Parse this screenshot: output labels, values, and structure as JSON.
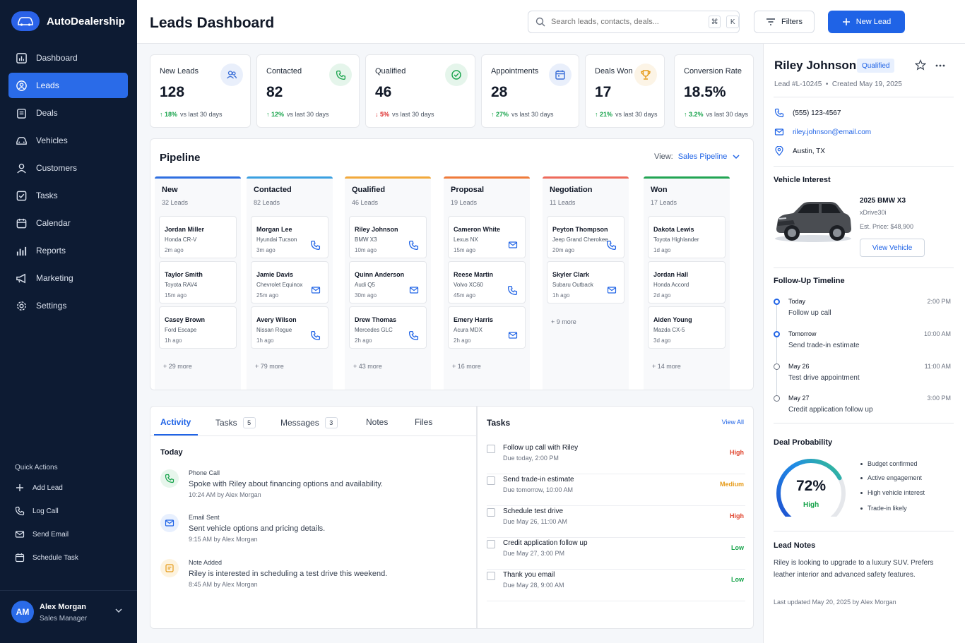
{
  "app": {
    "name": "AutoDealership"
  },
  "sidebar": {
    "items": [
      {
        "label": "Dashboard",
        "icon": "dashboard-icon"
      },
      {
        "label": "Leads",
        "icon": "leads-icon",
        "active": true
      },
      {
        "label": "Deals",
        "icon": "deals-icon"
      },
      {
        "label": "Vehicles",
        "icon": "car-icon"
      },
      {
        "label": "Customers",
        "icon": "user-icon"
      },
      {
        "label": "Tasks",
        "icon": "checkbox-icon"
      },
      {
        "label": "Calendar",
        "icon": "calendar-icon"
      },
      {
        "label": "Reports",
        "icon": "bar-chart-icon"
      },
      {
        "label": "Marketing",
        "icon": "megaphone-icon"
      },
      {
        "label": "Settings",
        "icon": "gear-icon"
      }
    ],
    "quick_actions_title": "Quick Actions",
    "quick_actions": [
      {
        "label": "Add Lead",
        "icon": "plus-icon"
      },
      {
        "label": "Log Call",
        "icon": "phone-icon"
      },
      {
        "label": "Send Email",
        "icon": "mail-icon"
      },
      {
        "label": "Schedule Task",
        "icon": "calendar-icon"
      }
    ],
    "user": {
      "initials": "AM",
      "name": "Alex Morgan",
      "role": "Sales Manager"
    }
  },
  "header": {
    "title": "Leads Dashboard",
    "search_placeholder": "Search leads, contacts, deals...",
    "kbd1": "⌘",
    "kbd2": "K",
    "filters_label": "Filters",
    "new_lead_label": "New Lead"
  },
  "stats": [
    {
      "label": "New Leads",
      "value": "128",
      "change": "18%",
      "direction": "up",
      "suffix": "vs last 30 days",
      "icon": "users-icon",
      "color": "#3b6fd8"
    },
    {
      "label": "Contacted",
      "value": "82",
      "change": "12%",
      "direction": "up",
      "suffix": "vs last 30 days",
      "icon": "phone-icon",
      "color": "#16a34a"
    },
    {
      "label": "Qualified",
      "value": "46",
      "change": "5%",
      "direction": "down",
      "suffix": "vs last 30 days",
      "icon": "check-circle-icon",
      "color": "#16a34a"
    },
    {
      "label": "Appointments",
      "value": "28",
      "change": "27%",
      "direction": "up",
      "suffix": "vs last 30 days",
      "icon": "calendar-icon",
      "color": "#3b6fd8"
    },
    {
      "label": "Deals Won",
      "value": "17",
      "change": "21%",
      "direction": "up",
      "suffix": "vs last 30 days",
      "icon": "trophy-icon",
      "color": "#e69b1a"
    },
    {
      "label": "Conversion Rate",
      "value": "18.5%",
      "change": "3.2%",
      "direction": "up",
      "suffix": "vs last 30 days",
      "icon": "none",
      "color": "#16a34a"
    }
  ],
  "pipeline": {
    "title": "Pipeline",
    "view_label": "View:",
    "view_value": "Sales Pipeline",
    "columns": [
      {
        "name": "New",
        "count": "32 Leads",
        "color": "#2f6fe0",
        "more": "+ 29 more",
        "cards": [
          {
            "name": "Jordan Miller",
            "car": "Honda CR-V",
            "time": "2m ago",
            "icon": ""
          },
          {
            "name": "Taylor Smith",
            "car": "Toyota RAV4",
            "time": "15m ago",
            "icon": ""
          },
          {
            "name": "Casey Brown",
            "car": "Ford Escape",
            "time": "1h ago",
            "icon": ""
          }
        ]
      },
      {
        "name": "Contacted",
        "count": "82 Leads",
        "color": "#3aa0e0",
        "more": "+ 79 more",
        "cards": [
          {
            "name": "Morgan Lee",
            "car": "Hyundai Tucson",
            "time": "3m ago",
            "icon": "phone"
          },
          {
            "name": "Jamie Davis",
            "car": "Chevrolet Equinox",
            "time": "25m ago",
            "icon": "mail"
          },
          {
            "name": "Avery Wilson",
            "car": "Nissan Rogue",
            "time": "1h ago",
            "icon": "phone"
          }
        ]
      },
      {
        "name": "Qualified",
        "count": "46 Leads",
        "color": "#f2a93b",
        "more": "+ 43 more",
        "cards": [
          {
            "name": "Riley Johnson",
            "car": "BMW X3",
            "time": "10m ago",
            "icon": "phone"
          },
          {
            "name": "Quinn Anderson",
            "car": "Audi Q5",
            "time": "30m ago",
            "icon": "mail"
          },
          {
            "name": "Drew Thomas",
            "car": "Mercedes GLC",
            "time": "2h ago",
            "icon": "phone"
          }
        ]
      },
      {
        "name": "Proposal",
        "count": "19 Leads",
        "color": "#ef7b3a",
        "more": "+ 16 more",
        "cards": [
          {
            "name": "Cameron White",
            "car": "Lexus NX",
            "time": "15m ago",
            "icon": "mail"
          },
          {
            "name": "Reese Martin",
            "car": "Volvo XC60",
            "time": "45m ago",
            "icon": "phone"
          },
          {
            "name": "Emery Harris",
            "car": "Acura MDX",
            "time": "2h ago",
            "icon": "mail"
          }
        ]
      },
      {
        "name": "Negotiation",
        "count": "11 Leads",
        "color": "#ee6a5b",
        "more": "+ 9 more",
        "cards": [
          {
            "name": "Peyton Thompson",
            "car": "Jeep Grand Cherokee",
            "time": "20m ago",
            "icon": "phone"
          },
          {
            "name": "Skyler Clark",
            "car": "Subaru Outback",
            "time": "1h ago",
            "icon": "mail"
          }
        ]
      },
      {
        "name": "Won",
        "count": "17 Leads",
        "color": "#22a553",
        "more": "+ 14 more",
        "cards": [
          {
            "name": "Dakota Lewis",
            "car": "Toyota Highlander",
            "time": "1d ago",
            "icon": ""
          },
          {
            "name": "Jordan Hall",
            "car": "Honda Accord",
            "time": "2d ago",
            "icon": ""
          },
          {
            "name": "Aiden Young",
            "car": "Mazda CX-5",
            "time": "3d ago",
            "icon": ""
          }
        ]
      }
    ]
  },
  "activity": {
    "tabs": [
      {
        "label": "Activity"
      },
      {
        "label": "Tasks",
        "badge": "5"
      },
      {
        "label": "Messages",
        "badge": "3"
      },
      {
        "label": "Notes"
      },
      {
        "label": "Files"
      }
    ],
    "today_label": "Today",
    "items": [
      {
        "type": "Phone Call",
        "desc": "Spoke with Riley about financing options and availability.",
        "time": "10:24 AM",
        "by": "by Alex Morgan",
        "icon": "phone-icon"
      },
      {
        "type": "Email Sent",
        "desc": "Sent vehicle options and pricing details.",
        "time": "9:15 AM",
        "by": "by Alex Morgan",
        "icon": "mail-icon"
      },
      {
        "type": "Note Added",
        "desc": "Riley is interested in scheduling a test drive this weekend.",
        "time": "8:45 AM",
        "by": "by Alex Morgan",
        "icon": "note-icon"
      }
    ]
  },
  "tasks": {
    "title": "Tasks",
    "view_all": "View All",
    "items": [
      {
        "title": "Follow up call with Riley",
        "due": "Due today, 2:00 PM",
        "priority": "High",
        "color": "#e0452f"
      },
      {
        "title": "Send trade-in estimate",
        "due": "Due tomorrow, 10:00 AM",
        "priority": "Medium",
        "color": "#e69b1a"
      },
      {
        "title": "Schedule test drive",
        "due": "Due May 26, 11:00 AM",
        "priority": "High",
        "color": "#e0452f"
      },
      {
        "title": "Credit application follow up",
        "due": "Due May 27, 3:00 PM",
        "priority": "Low",
        "color": "#16a34a"
      },
      {
        "title": "Thank you email",
        "due": "Due May 28, 9:00 AM",
        "priority": "Low",
        "color": "#16a34a"
      }
    ]
  },
  "lead": {
    "name": "Riley Johnson",
    "status": "Qualified",
    "id": "Lead #L-10245",
    "created": "Created May 19, 2025",
    "phone": "(555) 123-4567",
    "email": "riley.johnson@email.com",
    "location": "Austin, TX",
    "vehicle_section": "Vehicle Interest",
    "vehicle": {
      "title": "2025 BMW X3",
      "trim": "xDrive30i",
      "price": "Est. Price: $48,900",
      "button": "View Vehicle"
    },
    "timeline_section": "Follow-Up Timeline",
    "timeline": [
      {
        "day": "Today",
        "task": "Follow up call",
        "time": "2:00 PM",
        "active": true
      },
      {
        "day": "Tomorrow",
        "task": "Send trade-in estimate",
        "time": "10:00 AM",
        "active": true
      },
      {
        "day": "May 26",
        "task": "Test drive appointment",
        "time": "11:00 AM",
        "active": false
      },
      {
        "day": "May 27",
        "task": "Credit application follow up",
        "time": "3:00 PM",
        "active": false
      }
    ],
    "probability_section": "Deal Probability",
    "probability": {
      "value": "72%",
      "fraction": 0.72,
      "label": "High"
    },
    "factors": [
      "Budget confirmed",
      "Active engagement",
      "High vehicle interest",
      "Trade-in likely"
    ],
    "notes_section": "Lead Notes",
    "notes": "Riley is looking to upgrade to a luxury SUV. Prefers leather interior and advanced safety features.",
    "updated": "Last updated May 20, 2025 by Alex Morgan"
  }
}
